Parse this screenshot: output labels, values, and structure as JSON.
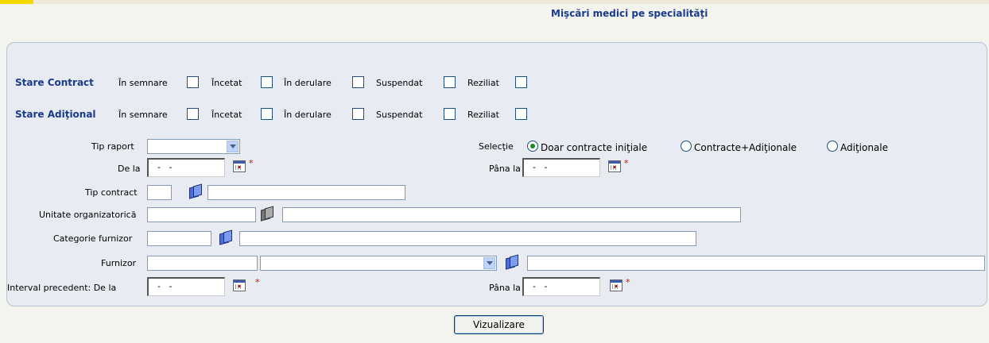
{
  "page_title": "Mişcări medici pe specialităţi",
  "status_groups": [
    {
      "title": "Stare Contract",
      "options": [
        "În semnare",
        "Încetat",
        "În derulare",
        "Suspendat",
        "Reziliat"
      ]
    },
    {
      "title": "Stare Adiţional",
      "options": [
        "În semnare",
        "Încetat",
        "În derulare",
        "Suspendat",
        "Reziliat"
      ]
    }
  ],
  "fields": {
    "tip_raport": {
      "label": "Tip raport",
      "value": ""
    },
    "selectie": {
      "label": "Selecţie",
      "options": [
        "Doar contracte iniţiale",
        "Contracte+Adiţionale",
        "Adiţionale"
      ],
      "selected": "Doar contracte iniţiale"
    },
    "de_la": {
      "label": "De la",
      "value": "  -   -"
    },
    "pana_la": {
      "label": "Pâna la",
      "value": "  -   -"
    },
    "tip_contract": {
      "label": "Tip contract"
    },
    "unitate": {
      "label": "Unitate organizatorică"
    },
    "categorie": {
      "label": "Categorie furnizor"
    },
    "furnizor": {
      "label": "Furnizor"
    },
    "interval_de_la": {
      "label": "Interval precedent: De la",
      "value": "  -   -"
    },
    "interval_pana_la": {
      "label": "Pâna la",
      "value": "  -   -"
    },
    "required_mark": "*"
  },
  "actions": {
    "view_button": "Vizualizare"
  }
}
